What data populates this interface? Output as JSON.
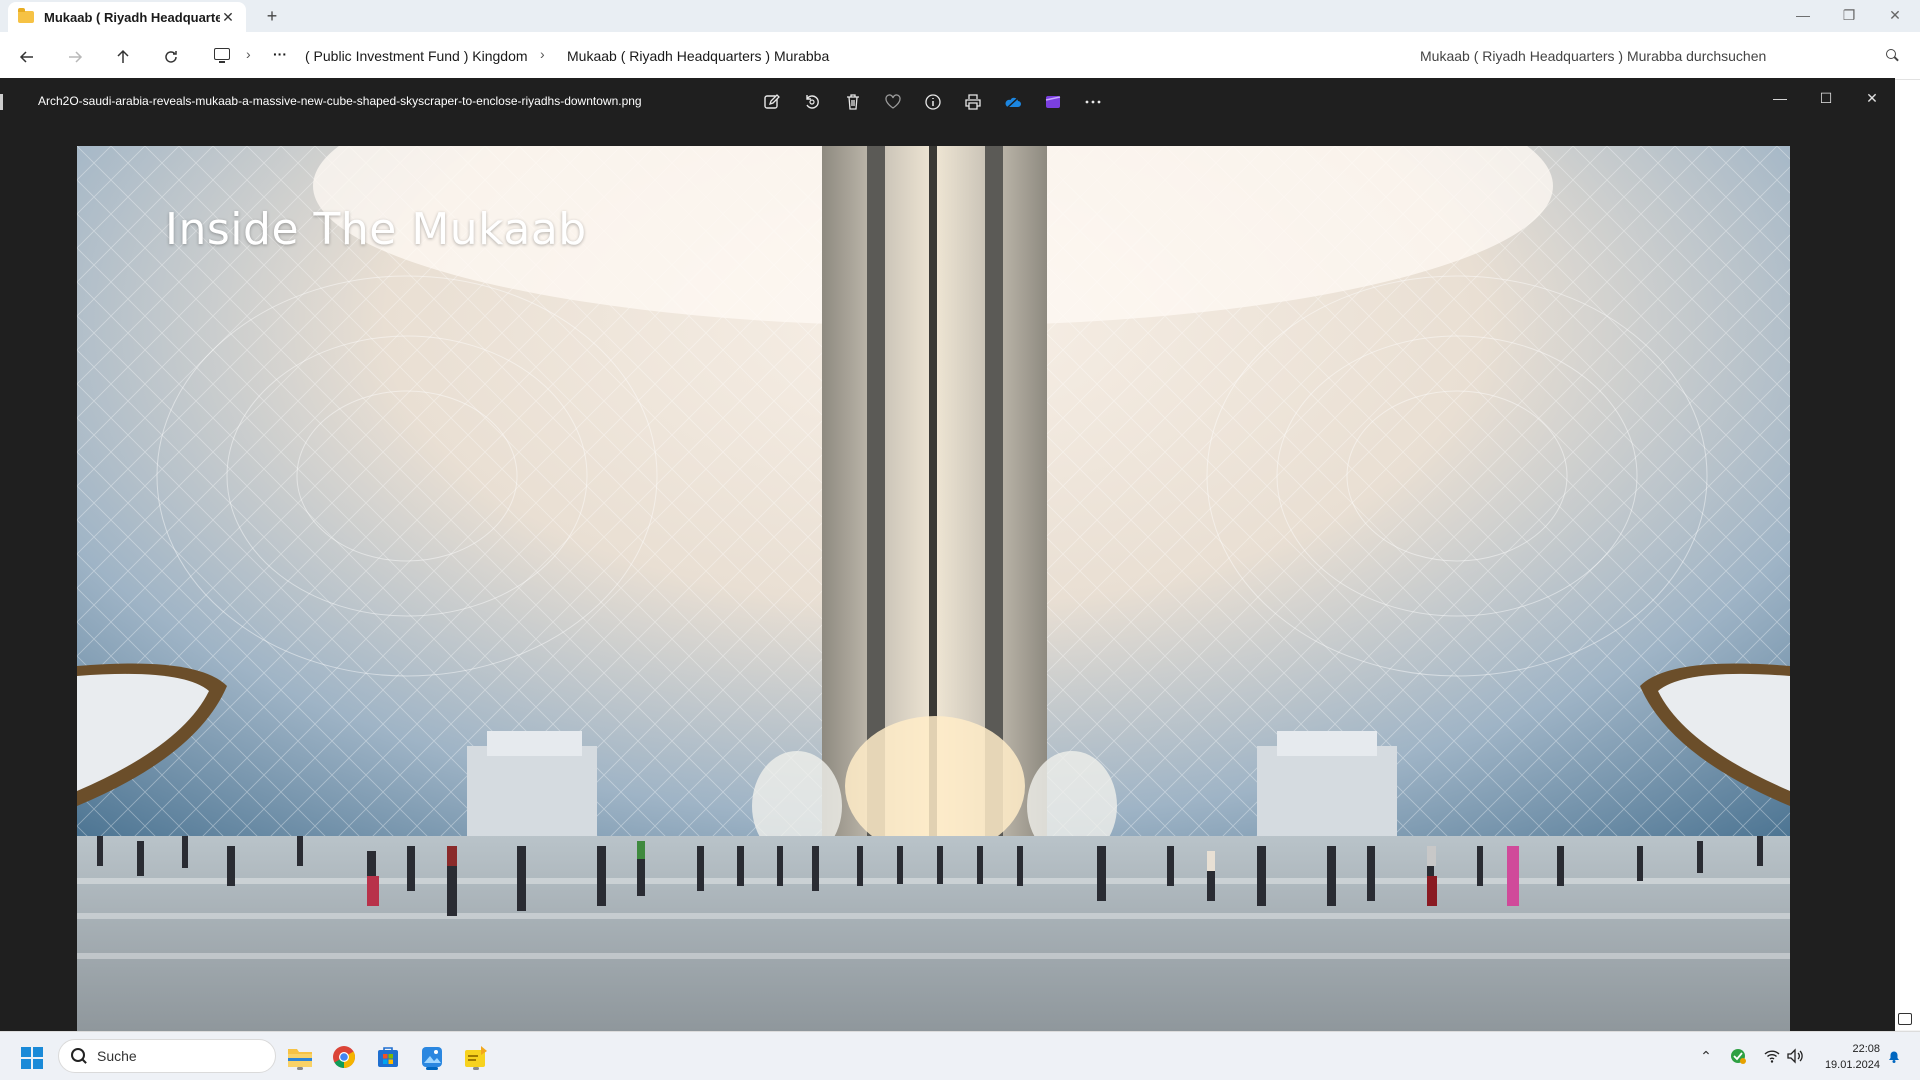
{
  "explorer": {
    "tab_title": "Mukaab ( Riyadh Headquarter",
    "breadcrumb": [
      "( Public Investment Fund ) Kingdom",
      "Mukaab ( Riyadh Headquarters ) Murabba"
    ],
    "search_placeholder": "Mukaab ( Riyadh Headquarters ) Murabba durchsuchen",
    "icons": {
      "back": "arrow-left-icon",
      "forward": "arrow-right-icon",
      "up": "arrow-up-icon",
      "refresh": "refresh-icon",
      "overflow": "more-icon"
    }
  },
  "viewer": {
    "filename": "Arch2O-saudi-arabia-reveals-mukaab-a-massive-new-cube-shaped-skyscraper-to-enclose-riyadhs-downtown.png",
    "image_title": "Inside The Mukaab",
    "toolbar": [
      "edit-icon",
      "rotate-icon",
      "delete-icon",
      "favorite-icon",
      "info-icon",
      "print-icon",
      "onedrive-icon",
      "clipchamp-icon",
      "more-icon"
    ]
  },
  "taskbar": {
    "search_label": "Suche",
    "apps": [
      "file-explorer-icon",
      "chrome-icon",
      "microsoft-store-icon",
      "photos-icon",
      "sticky-app-icon"
    ],
    "time": "22:08",
    "date": "19.01.2024"
  },
  "colors": {
    "viewer_bg": "#1f1f1f",
    "taskbar_bg": "#eef1f6",
    "accent": "#0067c0",
    "folder": "#f6c244"
  }
}
